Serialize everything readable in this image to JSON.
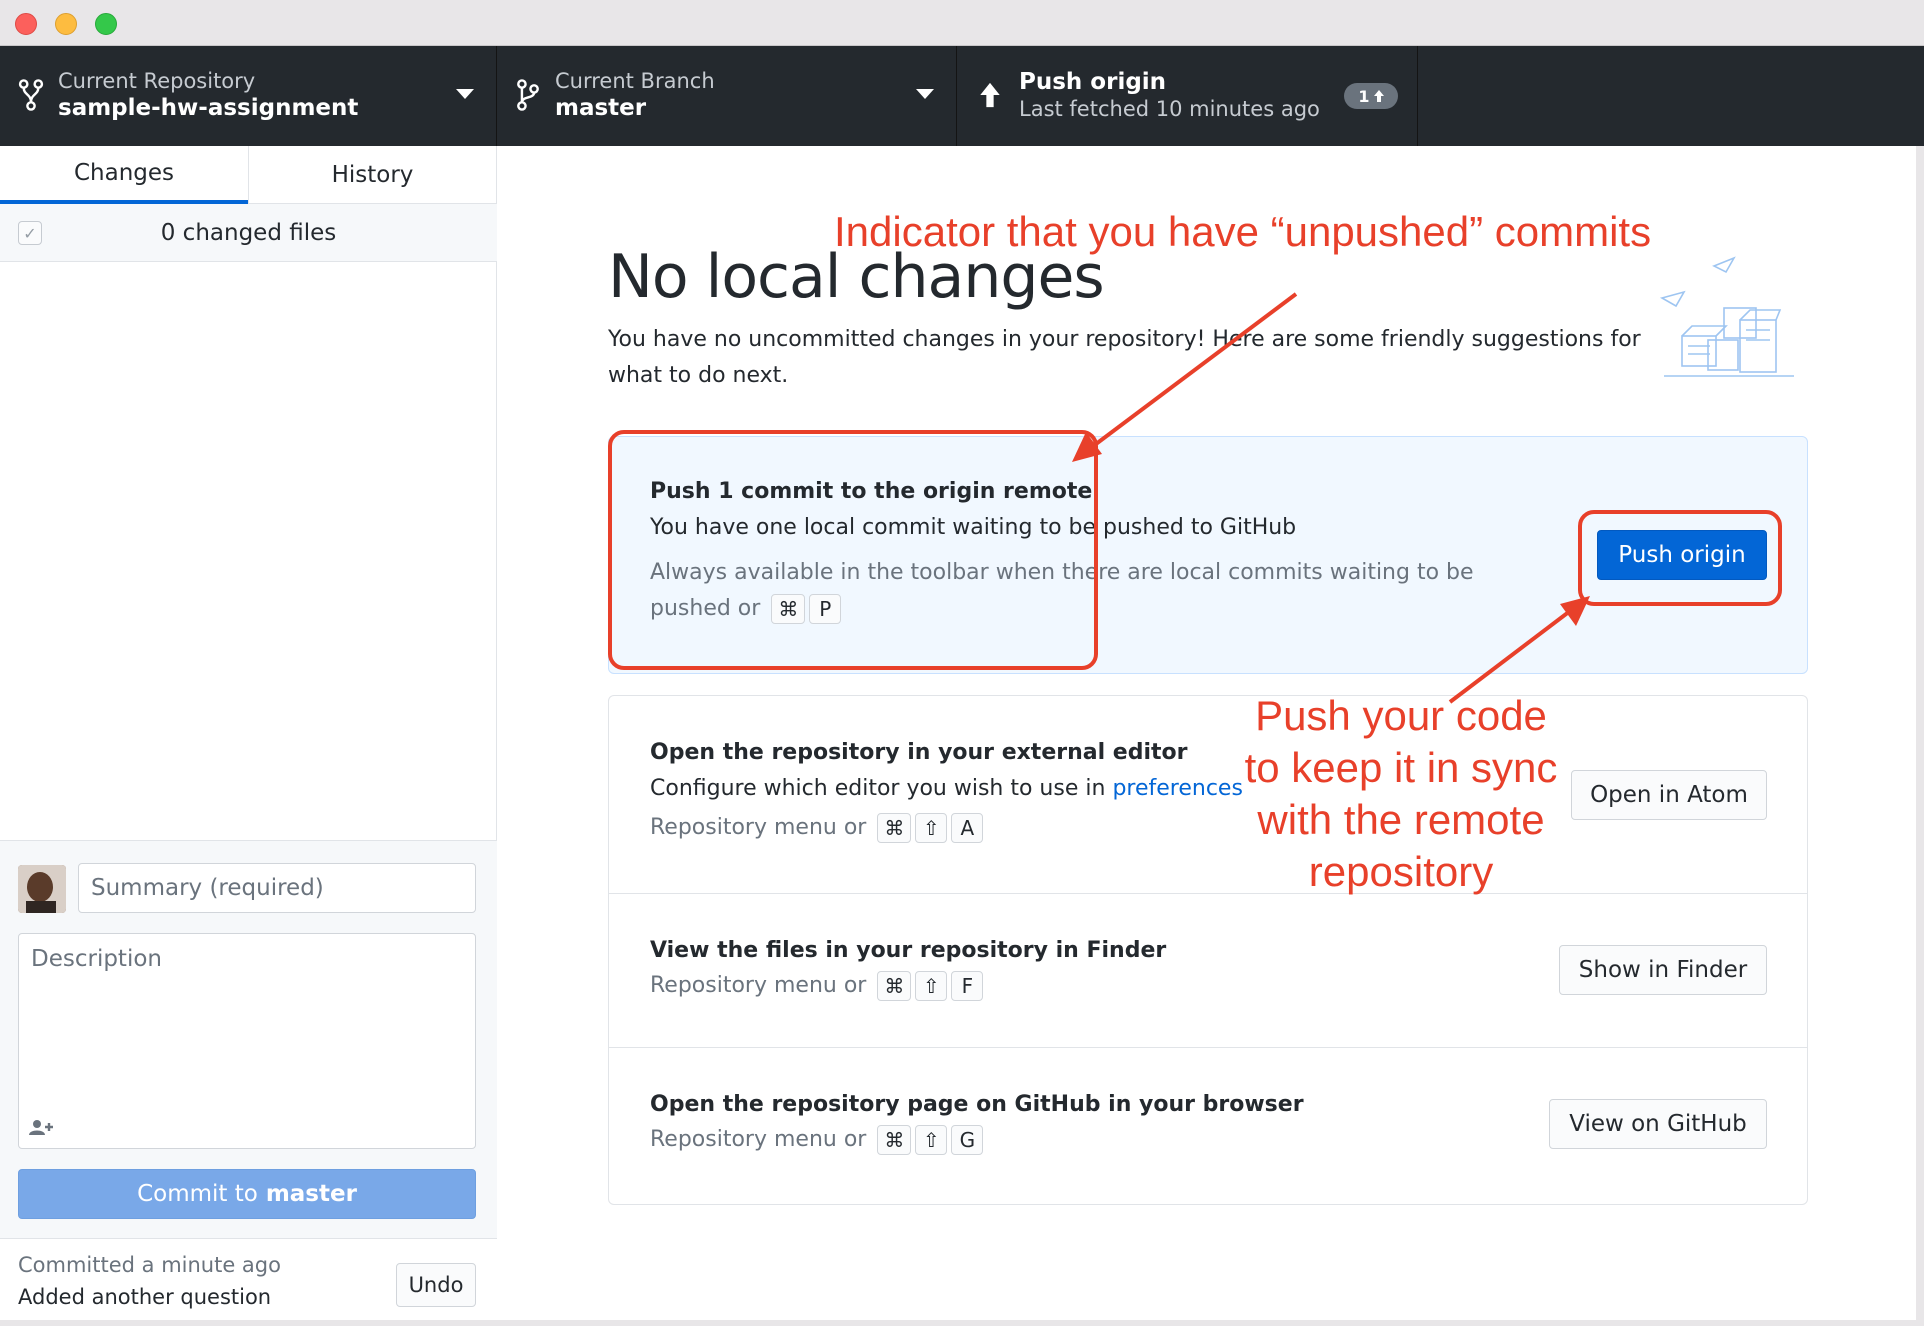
{
  "toolbar": {
    "repo_label": "Current Repository",
    "repo_name": "sample-hw-assignment",
    "branch_label": "Current Branch",
    "branch_name": "master",
    "push_title": "Push origin",
    "push_subtitle": "Last fetched 10 minutes ago",
    "push_count": "1"
  },
  "sidebar": {
    "tabs": [
      "Changes",
      "History"
    ],
    "changed_files": "0 changed files",
    "summary_placeholder": "Summary (required)",
    "description_placeholder": "Description",
    "commit_prefix": "Commit to",
    "commit_branch": "master",
    "last_commit_time": "Committed a minute ago",
    "last_commit_message": "Added another question",
    "undo_label": "Undo"
  },
  "main": {
    "title": "No local changes",
    "description": "You have no uncommitted changes in your repository! Here are some friendly suggestions for what to do next.",
    "push_card": {
      "title": "Push 1 commit to the origin remote",
      "line": "You have one local commit waiting to be pushed to GitHub",
      "hint": "Always available in the toolbar when there are local commits waiting to be pushed or",
      "keys": [
        "⌘",
        "P"
      ],
      "button": "Push origin"
    },
    "editor_card": {
      "title": "Open the repository in your external editor",
      "line_prefix": "Configure which editor you wish to use in",
      "line_link": "preferences",
      "hint": "Repository menu or",
      "keys": [
        "⌘",
        "⇧",
        "A"
      ],
      "button": "Open in Atom"
    },
    "finder_card": {
      "title": "View the files in your repository in Finder",
      "hint": "Repository menu or",
      "keys": [
        "⌘",
        "⇧",
        "F"
      ],
      "button": "Show in Finder"
    },
    "github_card": {
      "title": "Open the repository page on GitHub in your browser",
      "hint": "Repository menu or",
      "keys": [
        "⌘",
        "⇧",
        "G"
      ],
      "button": "View on GitHub"
    }
  },
  "annotations": {
    "top": "Indicator that you have “unpushed” commits",
    "side_lines": [
      "Push your code",
      "to keep it in sync",
      "with the remote",
      "repository"
    ],
    "color": "#e8402a"
  },
  "colors": {
    "toolbar_bg": "#24292e",
    "accent_blue": "#0366d6",
    "commit_button": "#79a8e8",
    "push_card_bg": "#f1f8ff"
  }
}
